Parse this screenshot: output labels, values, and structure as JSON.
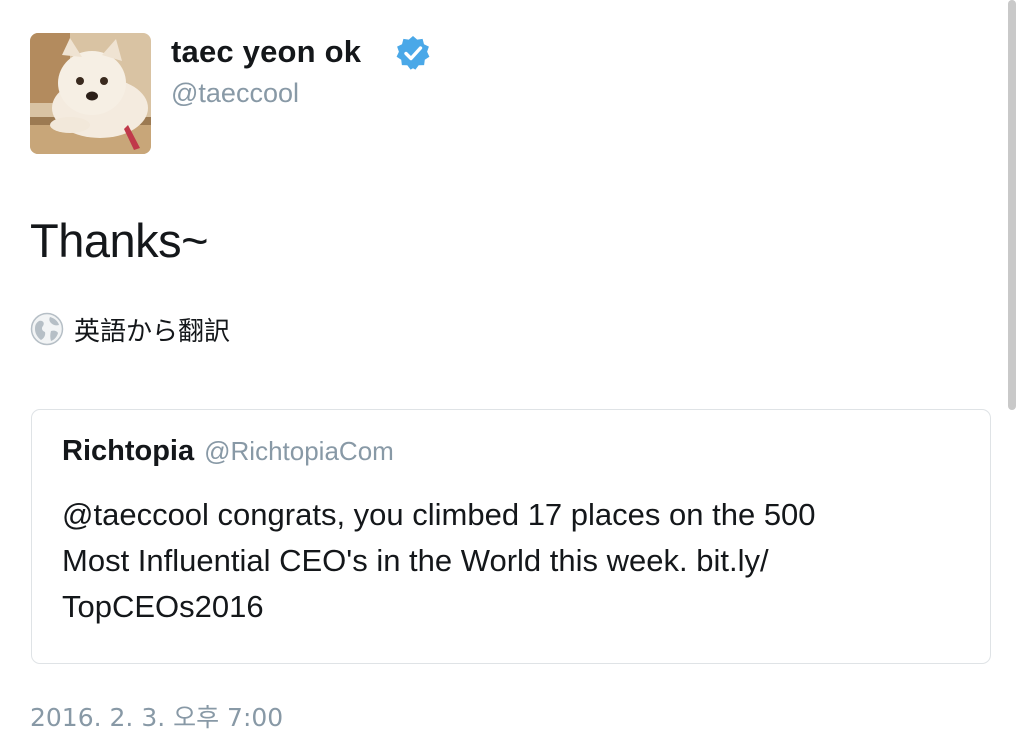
{
  "author": {
    "display_name": "taec yeon ok",
    "handle": "@taeccool",
    "verified": true,
    "avatar_icon": "dog-avatar"
  },
  "tweet": {
    "text": "Thanks~",
    "translate_label": "英語から翻訳",
    "translate_icon": "globe-icon",
    "timestamp": "2016. 2. 3. 오후 7:00"
  },
  "quoted_tweet": {
    "name": "Richtopia",
    "handle": "@RichtopiaCom",
    "lines": [
      "@taeccool congrats, you climbed 17 places on the 500",
      "Most Influential CEO's in the World this week. bit.ly/",
      "TopCEOs2016"
    ]
  },
  "colors": {
    "verified_badge": "#4aa8e8",
    "secondary_text": "#8899a6",
    "card_border": "#dfe3e6"
  }
}
